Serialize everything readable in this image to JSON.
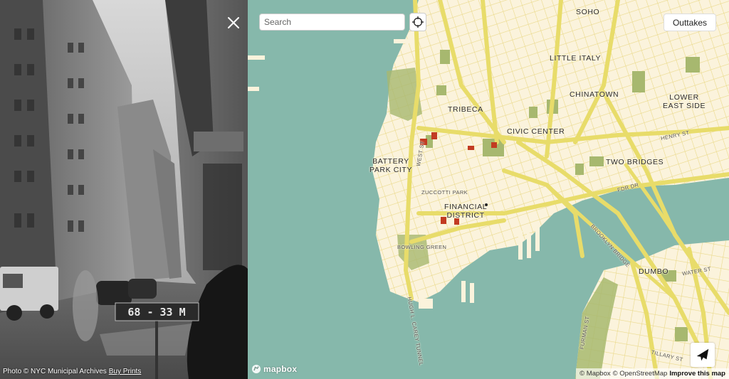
{
  "photo": {
    "sign_text": "68 - 33 M",
    "credit_text": "Photo © NYC Municipal Archives",
    "buy_prints_label": "Buy Prints",
    "close_icon": "close-icon"
  },
  "map": {
    "search": {
      "placeholder": "Search",
      "value": ""
    },
    "outtakes_label": "Outtakes",
    "mapbox_label": "mapbox",
    "attribution": {
      "mapbox": "© Mapbox",
      "osm": "© OpenStreetMap",
      "improve": "Improve this map"
    },
    "labels": {
      "soho": "SOHO",
      "little_italy": "LITTLE ITALY",
      "chinatown": "CHINATOWN",
      "lower_east_side_1": "LOWER",
      "lower_east_side_2": "EAST SIDE",
      "tribeca": "TRIBECA",
      "civic_center": "CIVIC CENTER",
      "battery_park_1": "BATTERY",
      "battery_park_2": "PARK CITY",
      "two_bridges": "TWO BRIDGES",
      "zuccotti": "ZUCCOTTI PARK",
      "financial_1": "FINANCIAL",
      "financial_2": "DISTRICT",
      "bowling_green": "BOWLING GREEN",
      "dumbo": "DUMBO",
      "west_st": "WEST ST",
      "fdr_dr": "FDR DR",
      "brooklyn_bridge": "BROOKLYN BRIDGE",
      "hugh_carey": "HUGH L. CAREY TUNNEL",
      "henry_st": "HENRY ST",
      "water_st": "WATER ST",
      "furman_st": "FURMAN ST",
      "tillary_st": "TILLARY ST"
    },
    "colors": {
      "water": "#86b8ab",
      "land": "#fbf3dc",
      "road": "#e8dc6a",
      "park": "#a7b86f",
      "marker": "#c23b22"
    },
    "icons": {
      "locate": "crosshair-icon",
      "plane": "airplane-icon"
    }
  }
}
